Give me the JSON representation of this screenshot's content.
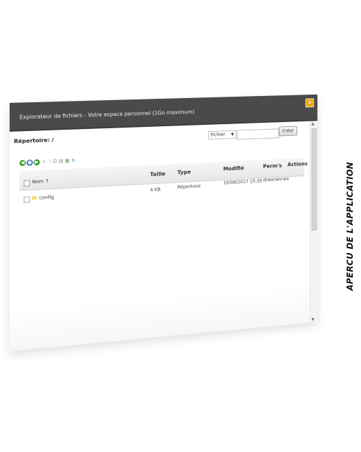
{
  "window": {
    "title": "Explorateur de fichiers - Votre espace personnel (1Go maximum)",
    "close_label": "×"
  },
  "toolbar_top": {
    "path_label": "Répertoire: /",
    "type_select_value": "Fichier",
    "name_input_value": "",
    "create_button_label": "Créer"
  },
  "toolbar_icons": [
    {
      "icon": "green-circle-icon",
      "color": "#3aa02b"
    },
    {
      "icon": "blue-circle-icon",
      "color": "#2f6fcf"
    },
    {
      "icon": "green-circle-icon",
      "color": "#3aa02b"
    },
    {
      "icon": "search-icon",
      "color": "#7a7a7a"
    },
    {
      "icon": "divider-icon",
      "color": "#9a9a9a"
    },
    {
      "icon": "person-icon",
      "color": "#5a8ac6"
    },
    {
      "icon": "copy-icon",
      "color": "#8c8c8c"
    },
    {
      "icon": "gallery-icon",
      "color": "#6c9c4a"
    },
    {
      "icon": "refresh-icon",
      "color": "#3b7ec4"
    }
  ],
  "table": {
    "headers": {
      "name": "Nom ↑",
      "size": "Taille",
      "type": "Type",
      "modified": "Modifié",
      "perms": "Perm's",
      "actions": "Actions"
    },
    "rows": [
      {
        "name": "config",
        "size": "4 KB",
        "type": "Répertoire",
        "modified": "10/08/2017 15:35",
        "perms": "drwxrwxrwx"
      }
    ]
  },
  "side_caption": "APERCU DE L'APPLICATION"
}
